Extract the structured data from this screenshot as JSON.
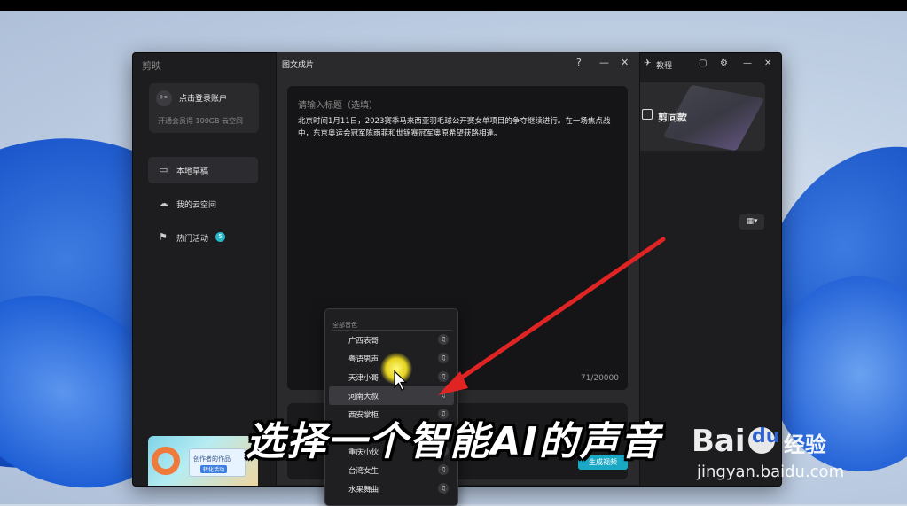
{
  "app": {
    "logo": "剪映",
    "login": {
      "title": "点击登录账户",
      "subtitle": "开通会员得 100GB 云空间"
    },
    "nav": [
      {
        "label": "本地草稿",
        "icon": "folder-icon"
      },
      {
        "label": "我的云空间",
        "icon": "cloud-icon"
      },
      {
        "label": "热门活动",
        "icon": "flag-icon",
        "badge": "5"
      }
    ],
    "promo": {
      "text": "创作者的作品",
      "sub": "转化活动"
    },
    "topbar": {
      "tutorial": "教程"
    },
    "jianyi": {
      "label": "剪同款"
    }
  },
  "dialog": {
    "title": "图文成片",
    "title_placeholder": "请输入标题（选填）",
    "body": "北京时间1月11日，2023赛季马来西亚羽毛球公开赛女单项目的争夺继续进行。在一场焦点战中，东京奥运会冠军陈雨菲和世锦赛冠军奥原希望获路相逢。",
    "count": "71/20000",
    "generate_label": "生成视频"
  },
  "dropdown": {
    "header": "全部音色",
    "items": [
      "广西表哥",
      "粤语男声",
      "天津小哥",
      "河南大叔",
      "西安掌柜",
      "",
      "重庆小伙",
      "台湾女生",
      "水果舞曲"
    ],
    "selected": "河南大叔"
  },
  "caption": "选择一个智能AI的声音",
  "watermark": {
    "brand": "Bai",
    "brand2": "du",
    "cn": "经验",
    "url": "jingyan.baidu.com"
  },
  "colors": {
    "accent": "#1aa9c5",
    "arrow": "#e02424",
    "badge": "#27b7c8"
  }
}
